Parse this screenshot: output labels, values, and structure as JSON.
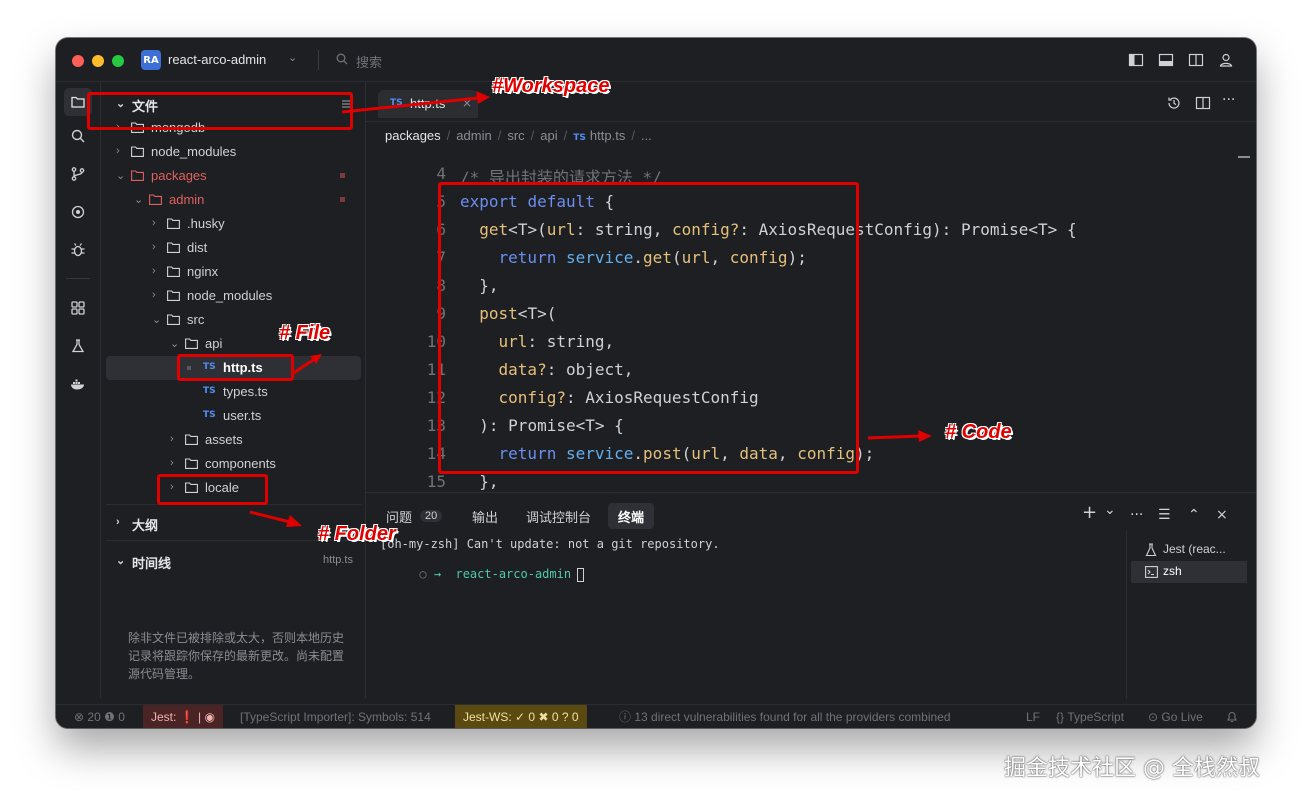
{
  "titlebar": {
    "workspace_badge": "RA",
    "workspace_name": "react-arco-admin",
    "search_placeholder": "搜索",
    "icons": [
      "toggle-sidebar-icon",
      "toggle-panel-icon",
      "split-view-icon",
      "account-icon"
    ]
  },
  "activity_bar": {
    "icons": [
      "explorer-icon",
      "search-icon",
      "source-control-icon",
      "remote-icon",
      "debug-icon",
      "extensions-icon",
      "testing-icon",
      "docker-icon"
    ]
  },
  "sidebar": {
    "files_header": "文件",
    "tree": [
      {
        "label": "mongodb",
        "type": "folder"
      },
      {
        "label": "node_modules",
        "type": "folder"
      },
      {
        "label": "packages",
        "type": "folder"
      },
      {
        "label": "admin",
        "type": "folder"
      },
      {
        "label": ".husky",
        "type": "folder"
      },
      {
        "label": "dist",
        "type": "folder"
      },
      {
        "label": "nginx",
        "type": "folder"
      },
      {
        "label": "node_modules",
        "type": "folder"
      },
      {
        "label": "src",
        "type": "folder"
      },
      {
        "label": "api",
        "type": "folder"
      },
      {
        "label": "http.ts",
        "type": "file"
      },
      {
        "label": "types.ts",
        "type": "file"
      },
      {
        "label": "user.ts",
        "type": "file"
      },
      {
        "label": "assets",
        "type": "folder"
      },
      {
        "label": "components",
        "type": "folder"
      },
      {
        "label": "locale",
        "type": "folder"
      }
    ],
    "ts_badge": "TS",
    "outline_header": "大纲",
    "timeline_header": "时间线",
    "timeline_file": "http.ts",
    "timeline_note": "除非文件已被排除或太大，否则本地历史记录将跟踪你保存的最新更改。尚未配置源代码管理。"
  },
  "editor": {
    "tab_badge": "TS",
    "tab_label": "http.ts",
    "breadcrumbs": [
      "packages",
      "admin",
      "src",
      "api",
      "http.ts",
      "..."
    ],
    "code": [
      {
        "n": "4",
        "text": "/* 导出封装的请求方法 */"
      },
      {
        "n": "5",
        "text": "export default {"
      },
      {
        "n": "6",
        "text": "  get<T>(url: string, config?: AxiosRequestConfig): Promise<T> {"
      },
      {
        "n": "7",
        "text": "    return service.get(url, config);"
      },
      {
        "n": "8",
        "text": "  },"
      },
      {
        "n": "9",
        "text": "  post<T>("
      },
      {
        "n": "10",
        "text": "    url: string,"
      },
      {
        "n": "11",
        "text": "    data?: object,"
      },
      {
        "n": "12",
        "text": "    config?: AxiosRequestConfig"
      },
      {
        "n": "13",
        "text": "  ): Promise<T> {"
      },
      {
        "n": "14",
        "text": "    return service.post(url, data, config);"
      },
      {
        "n": "15",
        "text": "  },"
      }
    ]
  },
  "panel": {
    "tabs": [
      {
        "label": "问题",
        "count": "20"
      },
      {
        "label": "输出"
      },
      {
        "label": "调试控制台"
      },
      {
        "label": "终端"
      }
    ],
    "terminal_lines": [
      "[oh-my-zsh] Can't update: not a git repository.",
      "→  react-arco-admin"
    ],
    "terminals": [
      "Jest (reac...",
      "zsh"
    ],
    "controls": [
      "+",
      "⌄",
      "···",
      "☰",
      "⌃",
      "×"
    ]
  },
  "statusbar": {
    "errors": "20",
    "warnings": "0",
    "jest": "Jest:",
    "ts_importer": "[TypeScript Importer]: Symbols: 514",
    "jest_ws": "Jest-WS:",
    "jest_ws_pass": "0",
    "jest_ws_fail": "0",
    "jest_ws_unknown": "0",
    "vulnerabilities": "13 direct vulnerabilities found for all the providers combined",
    "eol": "LF",
    "language": "TypeScript",
    "golive": "Go Live"
  },
  "annotations": {
    "workspace": "#Workspace",
    "file": "# File",
    "code": "# Code",
    "folder": "# Folder"
  },
  "watermark": "掘金技术社区 @ 全栈然叔"
}
